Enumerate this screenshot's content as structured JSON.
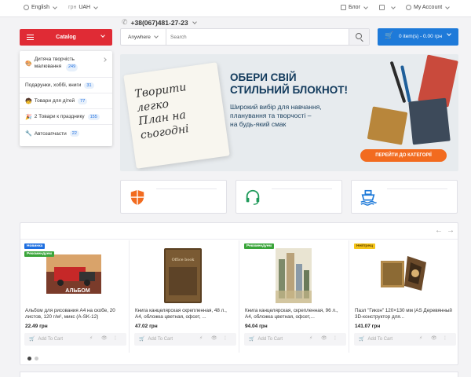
{
  "colors": {
    "accent_red": "#e02b35",
    "accent_blue": "#1e7ad9",
    "orange": "#f26b1f",
    "badge_blue": "#1e6fe0"
  },
  "topbar": {
    "language": "English",
    "currency_symbol": "грн",
    "currency": "UAH",
    "blog": "Блог",
    "account": "My Account"
  },
  "phone": "+38(067)481-27-23",
  "catalog": {
    "label": "Catalog",
    "items": [
      {
        "label": "Дитяча творчість малювання",
        "count": "249",
        "icon": "palette-icon"
      },
      {
        "label": "Подарунки, хоббі, книги",
        "count": "31",
        "icon": ""
      },
      {
        "label": "Товари для дітей",
        "count": "77",
        "icon": "child-icon"
      },
      {
        "label": "2 Товари к празднику",
        "count": "155",
        "icon": "party-icon"
      },
      {
        "label": "Автозапчасти",
        "count": "22",
        "icon": "wrench-icon"
      }
    ]
  },
  "search": {
    "scope": "Anywhere",
    "placeholder": "Search"
  },
  "cart": {
    "label": "0 item(s) - 0.00 грн"
  },
  "banner": {
    "notebook_line1": "Творити",
    "notebook_line2": "легко",
    "notebook_line3": "План на",
    "notebook_line4": "сьогодні",
    "title_line1": "ОБЕРИ СВІЙ",
    "title_line2": "СТИЛЬНИЙ БЛОКНОТ!",
    "subtitle_line1": "Широкий вибір для навчання,",
    "subtitle_line2": "планування та творчості –",
    "subtitle_line3": "на будь-який смак",
    "button": "ПЕРЕЙТИ ДО КАТЕГОРІЇ"
  },
  "features": [
    {
      "icon": "shield-icon"
    },
    {
      "icon": "headset-icon"
    },
    {
      "icon": "ship-icon"
    }
  ],
  "products": [
    {
      "tags": [
        "Новинка",
        "Рекомендуем"
      ],
      "name": "Альбом для рисования А4 на скобе, 20 листов, 120 г/м², микс (A-SK-12)",
      "price": "22.49 грн",
      "add": "Add To Cart"
    },
    {
      "tags": [],
      "name": "Книга канцелярская скрепленная, 48 л., А4, обложка цветная, офсет, ...",
      "price": "47.02 грн",
      "add": "Add To Cart"
    },
    {
      "tags": [
        "Рекомендуем"
      ],
      "name": "Книга канцелярская, скрепленная, 96 л., А4, обложка цветная, офсет,...",
      "price": "94.04 грн",
      "add": "Add To Cart"
    },
    {
      "tags": [
        "Нейтрещ"
      ],
      "name": "Пазл \"Гикон\" 120×130 мм |AS Деревянный 3D-конструктор для...",
      "price": "141.07 грн",
      "add": "Add To Cart"
    }
  ],
  "album_text": "АЛЬБОМ",
  "office_book_text": "Office book"
}
